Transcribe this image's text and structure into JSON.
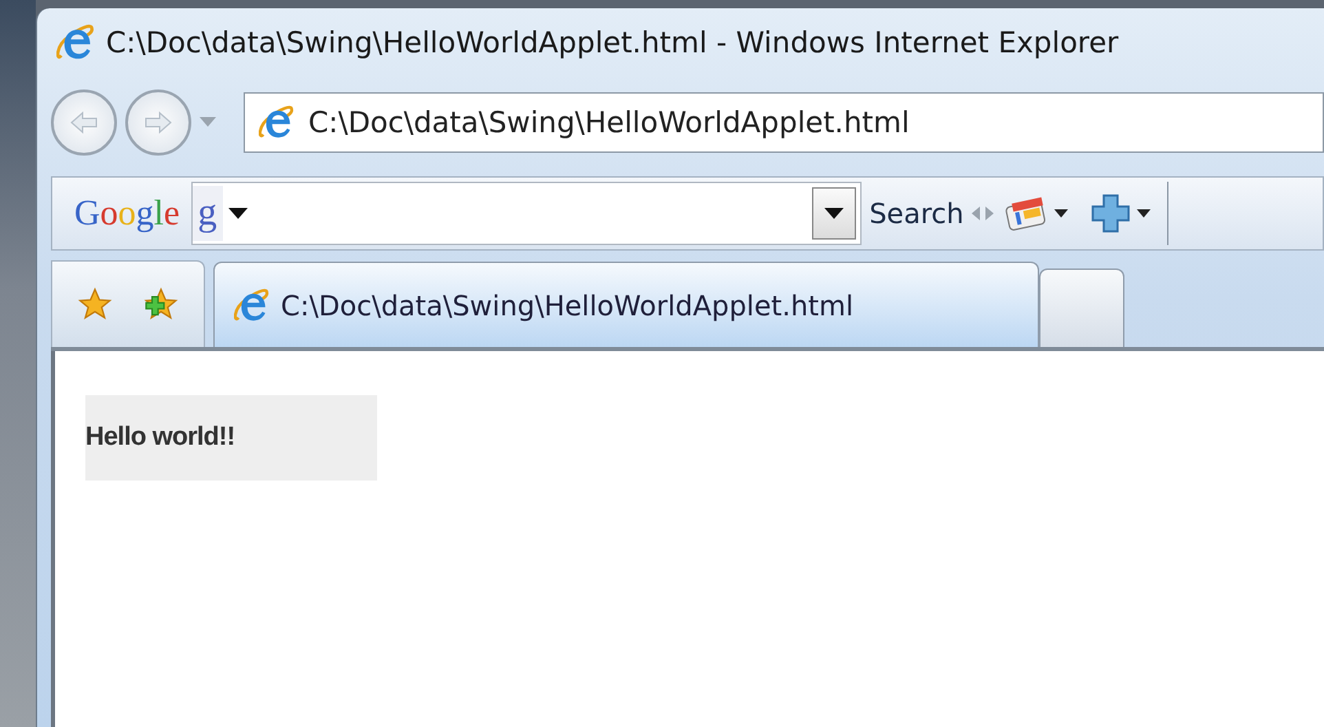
{
  "window": {
    "title": "C:\\Doc\\data\\Swing\\HelloWorldApplet.html - Windows Internet Explorer"
  },
  "address_bar": {
    "value": "C:\\Doc\\data\\Swing\\HelloWorldApplet.html"
  },
  "google_toolbar": {
    "logo": "Google",
    "engine_glyph": "g",
    "search_button": "Search"
  },
  "tabs": [
    {
      "label": "C:\\Doc\\data\\Swing\\HelloWorldApplet.html",
      "selected": true
    }
  ],
  "page": {
    "applet_text": "Hello world!!"
  }
}
